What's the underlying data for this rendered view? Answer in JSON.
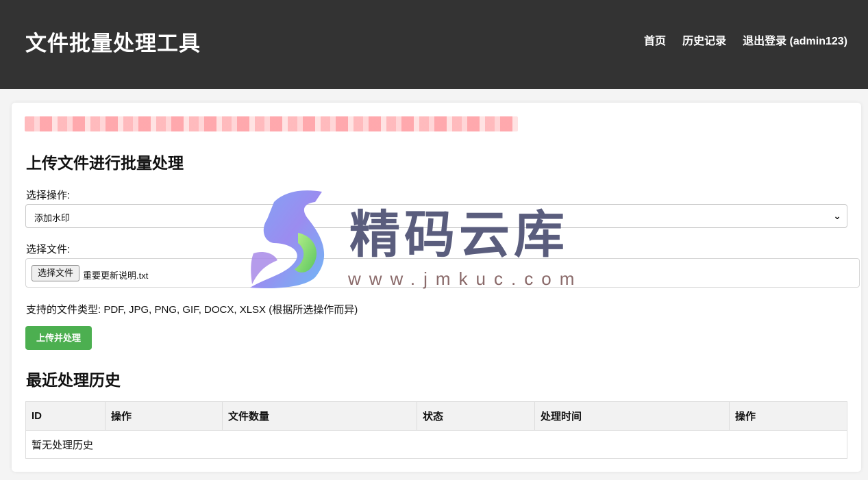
{
  "header": {
    "title": "文件批量处理工具",
    "nav": [
      "首页",
      "历史记录",
      "退出登录 (admin123)"
    ]
  },
  "upload": {
    "title": "上传文件进行批量处理",
    "operation_label": "选择操作:",
    "operation_value": "添加水印",
    "file_label": "选择文件:",
    "file_button": "选择文件",
    "file_name": "重要更新说明.txt",
    "hint": "支持的文件类型: PDF, JPG, PNG, GIF, DOCX, XLSX (根据所选操作而异)",
    "submit_label": "上传并处理"
  },
  "history": {
    "title": "最近处理历史",
    "columns": [
      "ID",
      "操作",
      "文件数量",
      "状态",
      "处理时间",
      "操作"
    ],
    "empty_text": "暂无处理历史"
  },
  "watermark": {
    "text": "精码云库",
    "url": "www.jmkuc.com"
  },
  "colors": {
    "header_bg": "#333333",
    "submit_bg": "#4caf50"
  }
}
